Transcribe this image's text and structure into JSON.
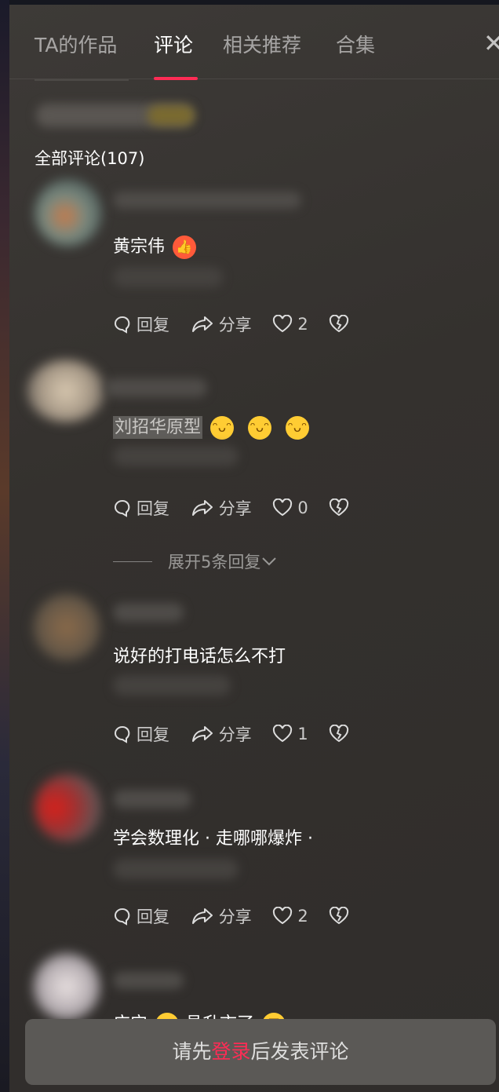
{
  "tabs": [
    {
      "label": "TA的作品"
    },
    {
      "label": "评论"
    },
    {
      "label": "相关推荐"
    },
    {
      "label": "合集"
    }
  ],
  "close_icon": "close-icon",
  "comments_count_label": "全部评论(107)",
  "comments": [
    {
      "text": "黄宗伟",
      "emojis": [
        "thumbs-up"
      ],
      "reply_label": "回复",
      "share_label": "分享",
      "likes": "2"
    },
    {
      "text": "刘招华原型",
      "emojis": [
        "grin",
        "grin",
        "grin"
      ],
      "reply_label": "回复",
      "share_label": "分享",
      "likes": "0",
      "expand_label": "展开5条回复"
    },
    {
      "text": "说好的打电话怎么不打",
      "reply_label": "回复",
      "share_label": "分享",
      "likes": "1"
    },
    {
      "text": "学会数理化 · 走哪哪爆炸 ·",
      "reply_label": "回复",
      "share_label": "分享",
      "likes": "2"
    },
    {
      "text_a": "广宁",
      "text_b": "县升市了",
      "emojis": [
        "kissing",
        "rofl"
      ]
    }
  ],
  "login_prompt": {
    "before": "请先",
    "link": "登录",
    "after": "后发表评论"
  },
  "colors": {
    "accent": "#fe2c55",
    "panel_bg": "#34312e"
  }
}
